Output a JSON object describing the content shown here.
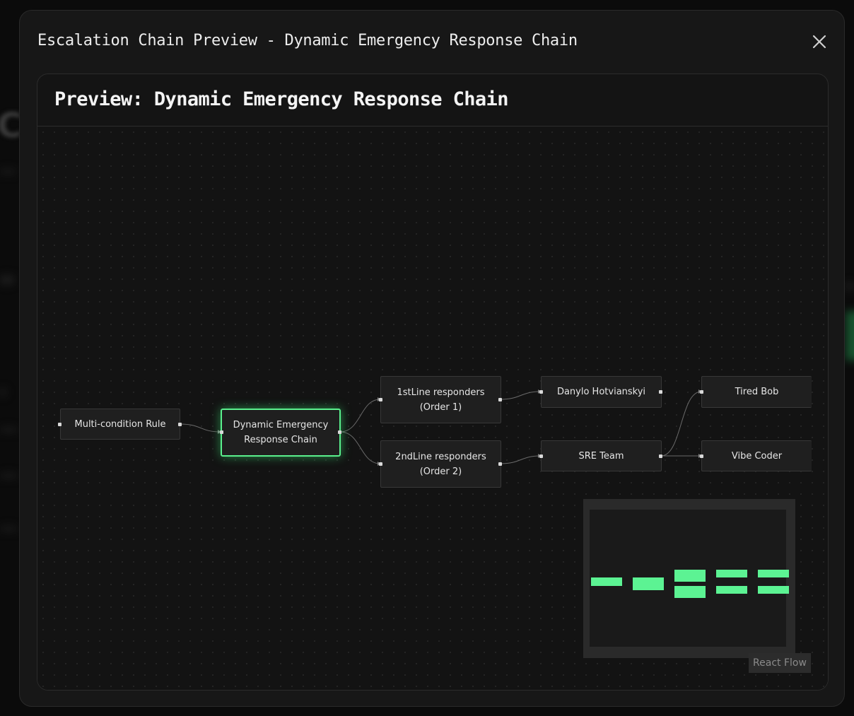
{
  "modal": {
    "title": "Escalation Chain Preview - Dynamic Emergency Response Chain",
    "close_icon": "close-icon"
  },
  "card": {
    "title": "Preview: Dynamic Emergency Response Chain"
  },
  "flow": {
    "nodes": {
      "rule": "Multi-condition Rule",
      "chain": "Dynamic Emergency\nResponse Chain",
      "first_line": "1stLine responders\n(Order 1)",
      "second_line": "2ndLine responders\n(Order 2)",
      "danylo": "Danylo Hotvianskyi",
      "sre_team": "SRE Team",
      "tired_bob": "Tired Bob",
      "vibe_coder": "Vibe Coder"
    },
    "attribution": "React Flow",
    "minimap_color": "#5cf393",
    "selected_color": "#5af08d"
  }
}
